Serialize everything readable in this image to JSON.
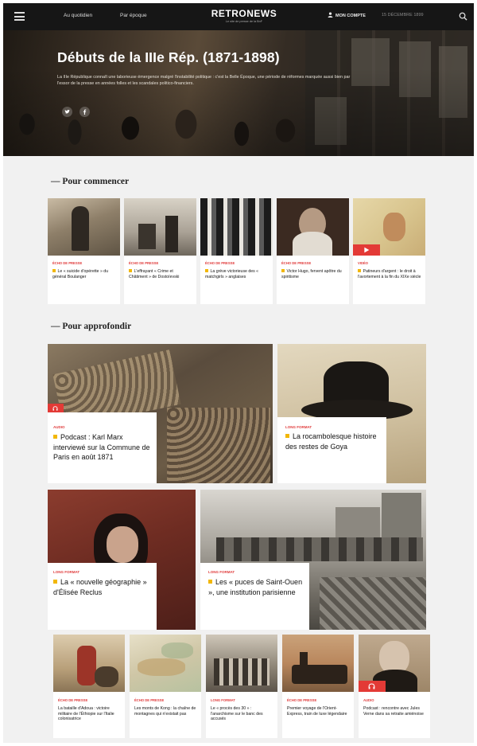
{
  "header": {
    "nav": [
      "Au quotidien",
      "Par époque"
    ],
    "logo": "RETRONEWS",
    "logo_tagline": "Le site de presse de la BnF",
    "account_label": "MON COMPTE",
    "date": "15 DÉCEMBRE 1899",
    "icons": [
      "menu-icon",
      "user-icon",
      "search-icon"
    ]
  },
  "hero": {
    "title": "Débuts de la IIIe Rép. (1871-1898)",
    "description": "La IIIe République connaît une laborieuse émergence malgré l'instabilité politique : c'est la Belle Époque, une période de réformes marquée aussi bien par l'essor de la presse en années folles et les scandales politico-financiers.",
    "share_icons": [
      "twitter-icon",
      "facebook-icon"
    ]
  },
  "sections": {
    "start": "— Pour commencer",
    "deep": "— Pour approfondir"
  },
  "start_cards": [
    {
      "category": "ÉCHO DE PRESSE",
      "title": "Le « suicide d'opérette » du général Boulanger"
    },
    {
      "category": "ÉCHO DE PRESSE",
      "title": "L'effrayant « Crime et Châtiment » de Dostoïevski"
    },
    {
      "category": "ÉCHO DE PRESSE",
      "title": "La grève victorieuse des « matchgirls » anglaises"
    },
    {
      "category": "ÉCHO DE PRESSE",
      "title": "Victor Hugo, fervent apôtre du spiritisme"
    },
    {
      "category": "VIDÉO",
      "title": "Patineurs d'argent : le droit à l'avortement à la fin du XIXe siècle"
    }
  ],
  "features": [
    {
      "category": "AUDIO",
      "title": "Podcast : Karl Marx interviewé sur la Commune de Paris en août 1871"
    },
    {
      "category": "LONG FORMAT",
      "title": "La rocambolesque histoire des restes de Goya"
    },
    {
      "category": "LONG FORMAT",
      "title": "La « nouvelle géographie » d'Élisée Reclus"
    },
    {
      "category": "LONG FORMAT",
      "title": "Les « puces de Saint-Ouen », une institution parisienne"
    }
  ],
  "bottom_cards": [
    {
      "category": "ÉCHO DE PRESSE",
      "title": "La bataille d'Adoua : victoire militaire de l'Éthiopie sur l'Italie colonisatrice"
    },
    {
      "category": "ÉCHO DE PRESSE",
      "title": "Les monts de Kong : la chaîne de montagnes qui n'existait pas"
    },
    {
      "category": "LONG FORMAT",
      "title": "Le « procès des 30 » : l'anarchisme sur le banc des accusés"
    },
    {
      "category": "ÉCHO DE PRESSE",
      "title": "Premier voyage de l'Orient-Express, train de luxe légendaire"
    },
    {
      "category": "AUDIO",
      "title": "Podcast : rencontre avec Jules Verne dans sa retraite amiénoise"
    }
  ],
  "colors": {
    "accent_red": "#e33a36",
    "bullet_yellow": "#f2b705",
    "topbar": "#161616",
    "background": "#f1f1f1"
  }
}
